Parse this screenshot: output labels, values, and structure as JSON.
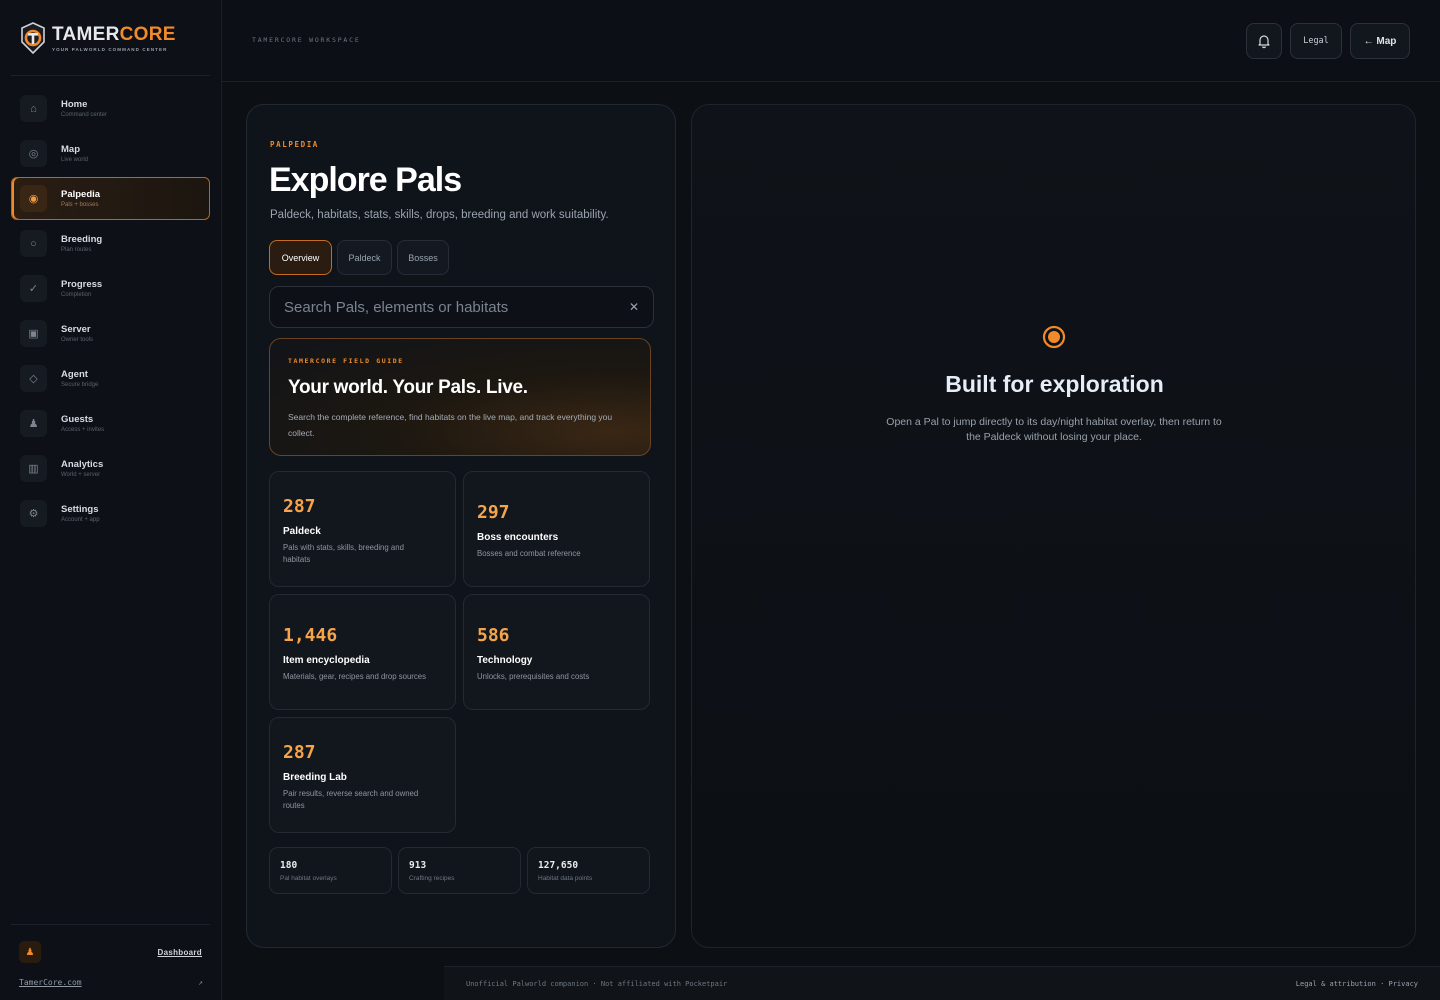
{
  "brand": {
    "name_a": "TAMER",
    "name_b": "CORE",
    "tagline": "YOUR PALWORLD COMMAND CENTER",
    "accent": "#f08a2a"
  },
  "sidebar": {
    "items": [
      {
        "label": "Home",
        "sub": "Command center",
        "icon": "home-icon",
        "glyph": "⌂",
        "active": false
      },
      {
        "label": "Map",
        "sub": "Live world",
        "icon": "map-target-icon",
        "glyph": "◎",
        "active": false
      },
      {
        "label": "Palpedia",
        "sub": "Pals + bosses",
        "icon": "palpedia-icon",
        "glyph": "◉",
        "active": true
      },
      {
        "label": "Breeding",
        "sub": "Plan routes",
        "icon": "breeding-icon",
        "glyph": "○",
        "active": false
      },
      {
        "label": "Progress",
        "sub": "Completion",
        "icon": "check-icon",
        "glyph": "✓",
        "active": false
      },
      {
        "label": "Server",
        "sub": "Owner tools",
        "icon": "server-icon",
        "glyph": "▣",
        "active": false
      },
      {
        "label": "Agent",
        "sub": "Secure bridge",
        "icon": "diamond-icon",
        "glyph": "◇",
        "active": false
      },
      {
        "label": "Guests",
        "sub": "Access + invites",
        "icon": "guests-icon",
        "glyph": "♟",
        "active": false
      },
      {
        "label": "Analytics",
        "sub": "World + server",
        "icon": "analytics-icon",
        "glyph": "▥",
        "active": false
      },
      {
        "label": "Settings",
        "sub": "Account + app",
        "icon": "settings-icon",
        "glyph": "⚙",
        "active": false
      }
    ],
    "user_glyph": "♟",
    "dashboard_link": "Dashboard",
    "site_link": "TamerCore.com",
    "external_glyph": "↗"
  },
  "topbar": {
    "workspace": "TAMERCORE WORKSPACE",
    "bell_icon": "bell-icon",
    "legal_label": "Legal",
    "map_label": "← Map"
  },
  "palpedia": {
    "eyebrow": "PALPEDIA",
    "title": "Explore Pals",
    "subtitle": "Paldeck, habitats, stats, skills, drops, breeding and work suitability.",
    "tabs": [
      {
        "label": "Overview",
        "active": true
      },
      {
        "label": "Paldeck",
        "active": false
      },
      {
        "label": "Bosses",
        "active": false
      }
    ],
    "search_placeholder": "Search Pals, elements or habitats",
    "clear_glyph": "✕",
    "guide": {
      "eyebrow": "TAMERCORE FIELD GUIDE",
      "title": "Your world. Your Pals. Live.",
      "text": "Search the complete reference, find habitats on the live map, and track everything you collect."
    },
    "cards": [
      {
        "num": "287",
        "title": "Paldeck",
        "desc": "Pals with stats, skills, breeding and habitats"
      },
      {
        "num": "297",
        "title": "Boss encounters",
        "desc": "Bosses and combat reference"
      },
      {
        "num": "1,446",
        "title": "Item encyclopedia",
        "desc": "Materials, gear, recipes and drop sources"
      },
      {
        "num": "586",
        "title": "Technology",
        "desc": "Unlocks, prerequisites and costs"
      },
      {
        "num": "287",
        "title": "Breeding Lab",
        "desc": "Pair results, reverse search and owned routes"
      }
    ],
    "mini_stats": [
      {
        "num": "180",
        "label": "Pal habitat overlays"
      },
      {
        "num": "913",
        "label": "Crafting recipes"
      },
      {
        "num": "127,650",
        "label": "Habitat data points"
      }
    ]
  },
  "detail": {
    "icon": "target-icon",
    "title": "Built for exploration",
    "text": "Open a Pal to jump directly to its day/night habitat overlay, then return to the Paldeck without losing your place."
  },
  "footer": {
    "left": "Unofficial Palworld companion · Not affiliated with Pocketpair",
    "right": "Legal & attribution · Privacy"
  }
}
